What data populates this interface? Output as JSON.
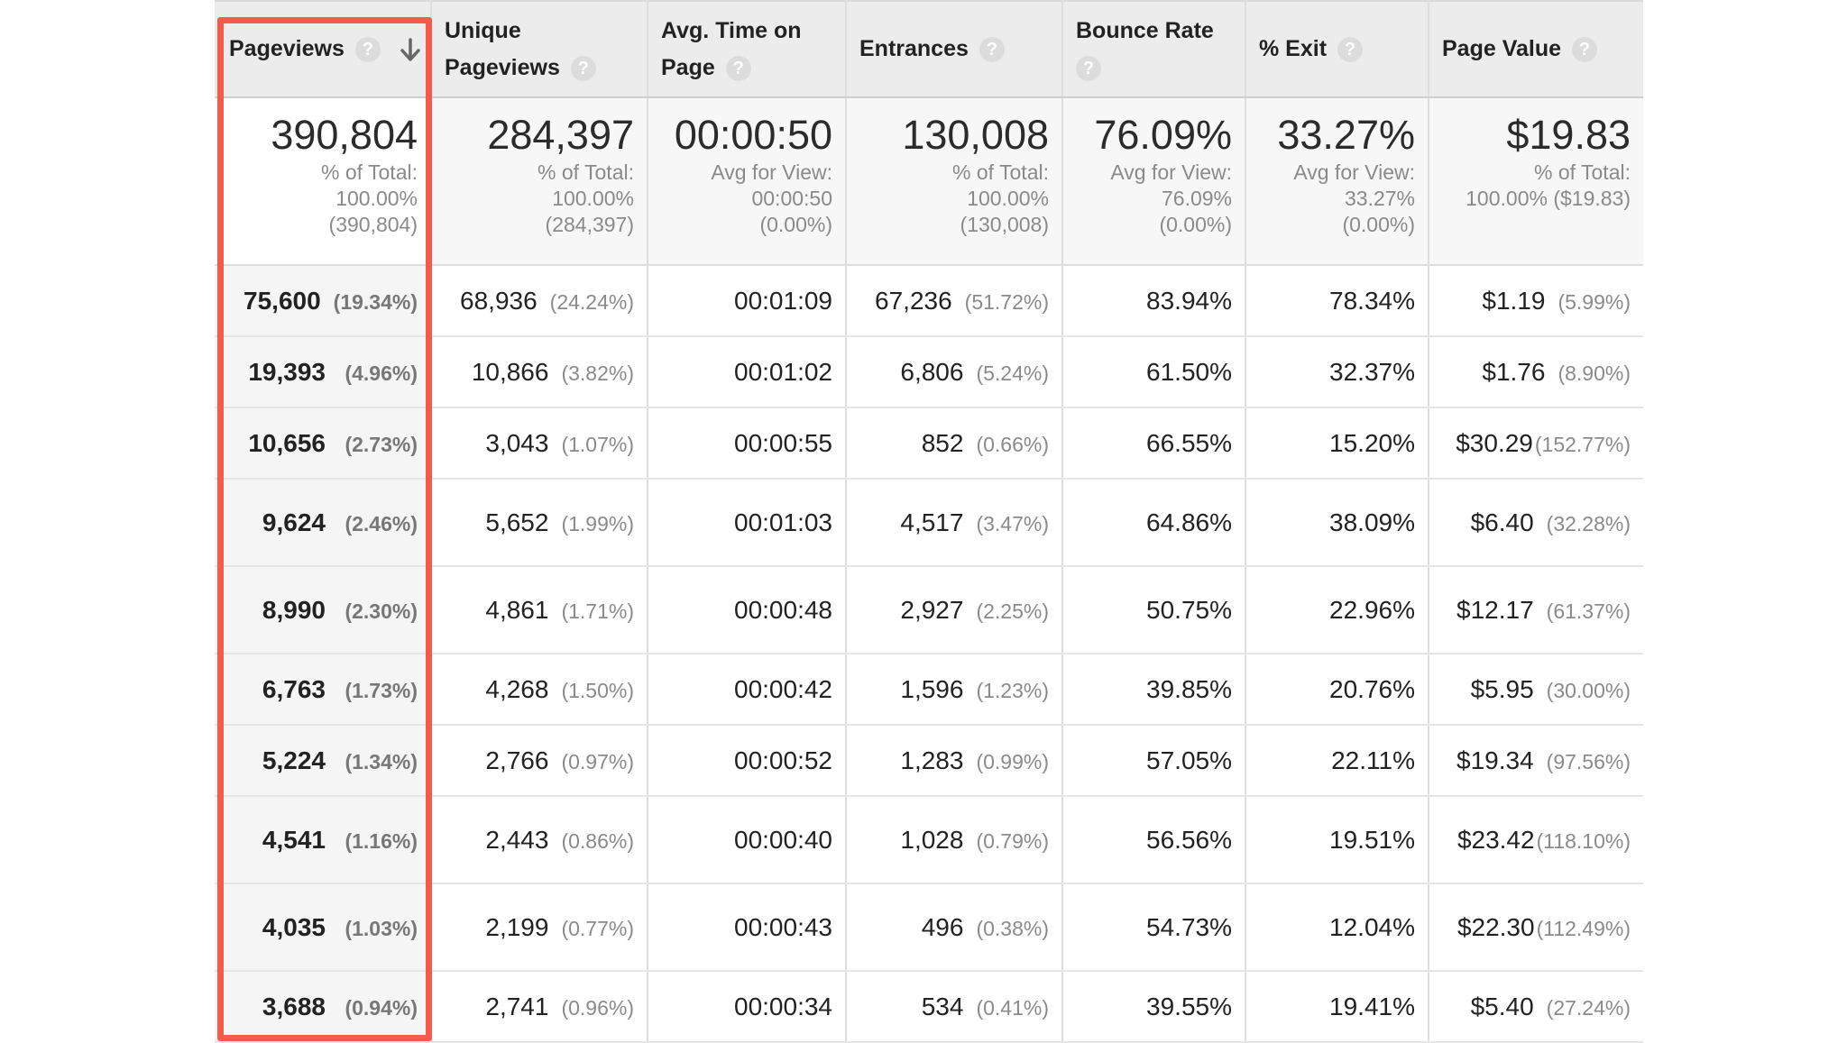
{
  "colors": {
    "highlight": "#f25c4d",
    "header_bg": "#ececec",
    "total_bg": "#f7f7f7"
  },
  "help_glyph": "?",
  "headers": [
    {
      "line1": "Pageviews",
      "line2": ""
    },
    {
      "line1": "Unique",
      "line2": "Pageviews"
    },
    {
      "line1": "Avg. Time on",
      "line2": "Page"
    },
    {
      "line1": "Entrances",
      "line2": ""
    },
    {
      "line1": "Bounce Rate",
      "line2": ""
    },
    {
      "line1": "% Exit",
      "line2": ""
    },
    {
      "line1": "Page Value",
      "line2": ""
    }
  ],
  "totals": [
    {
      "value": "390,804",
      "l1": "% of Total:",
      "l2": "100.00%",
      "l3": "(390,804)"
    },
    {
      "value": "284,397",
      "l1": "% of Total:",
      "l2": "100.00%",
      "l3": "(284,397)"
    },
    {
      "value": "00:00:50",
      "l1": "Avg for View:",
      "l2": "00:00:50",
      "l3": "(0.00%)"
    },
    {
      "value": "130,008",
      "l1": "% of Total:",
      "l2": "100.00%",
      "l3": "(130,008)"
    },
    {
      "value": "76.09%",
      "l1": "Avg for View:",
      "l2": "76.09%",
      "l3": "(0.00%)"
    },
    {
      "value": "33.27%",
      "l1": "Avg for View:",
      "l2": "33.27%",
      "l3": "(0.00%)"
    },
    {
      "value": "$19.83",
      "l1": "% of Total:",
      "l2": "100.00% ($19.83)",
      "l3": ""
    }
  ],
  "rows": [
    {
      "pv": "75,600",
      "pv_pct": "(19.34%)",
      "upv": "68,936",
      "upv_pct": "(24.24%)",
      "time": "00:01:09",
      "ent": "67,236",
      "ent_pct": "(51.72%)",
      "bounce": "83.94%",
      "exit": "78.34%",
      "value": "$1.19",
      "value_pct": "(5.99%)"
    },
    {
      "pv": "19,393",
      "pv_pct": "(4.96%)",
      "upv": "10,866",
      "upv_pct": "(3.82%)",
      "time": "00:01:02",
      "ent": "6,806",
      "ent_pct": "(5.24%)",
      "bounce": "61.50%",
      "exit": "32.37%",
      "value": "$1.76",
      "value_pct": "(8.90%)"
    },
    {
      "pv": "10,656",
      "pv_pct": "(2.73%)",
      "upv": "3,043",
      "upv_pct": "(1.07%)",
      "time": "00:00:55",
      "ent": "852",
      "ent_pct": "(0.66%)",
      "bounce": "66.55%",
      "exit": "15.20%",
      "value": "$30.29",
      "value_pct": "(152.77%)"
    },
    {
      "pv": "9,624",
      "pv_pct": "(2.46%)",
      "upv": "5,652",
      "upv_pct": "(1.99%)",
      "time": "00:01:03",
      "ent": "4,517",
      "ent_pct": "(3.47%)",
      "bounce": "64.86%",
      "exit": "38.09%",
      "value": "$6.40",
      "value_pct": "(32.28%)"
    },
    {
      "pv": "8,990",
      "pv_pct": "(2.30%)",
      "upv": "4,861",
      "upv_pct": "(1.71%)",
      "time": "00:00:48",
      "ent": "2,927",
      "ent_pct": "(2.25%)",
      "bounce": "50.75%",
      "exit": "22.96%",
      "value": "$12.17",
      "value_pct": "(61.37%)"
    },
    {
      "pv": "6,763",
      "pv_pct": "(1.73%)",
      "upv": "4,268",
      "upv_pct": "(1.50%)",
      "time": "00:00:42",
      "ent": "1,596",
      "ent_pct": "(1.23%)",
      "bounce": "39.85%",
      "exit": "20.76%",
      "value": "$5.95",
      "value_pct": "(30.00%)"
    },
    {
      "pv": "5,224",
      "pv_pct": "(1.34%)",
      "upv": "2,766",
      "upv_pct": "(0.97%)",
      "time": "00:00:52",
      "ent": "1,283",
      "ent_pct": "(0.99%)",
      "bounce": "57.05%",
      "exit": "22.11%",
      "value": "$19.34",
      "value_pct": "(97.56%)"
    },
    {
      "pv": "4,541",
      "pv_pct": "(1.16%)",
      "upv": "2,443",
      "upv_pct": "(0.86%)",
      "time": "00:00:40",
      "ent": "1,028",
      "ent_pct": "(0.79%)",
      "bounce": "56.56%",
      "exit": "19.51%",
      "value": "$23.42",
      "value_pct": "(118.10%)"
    },
    {
      "pv": "4,035",
      "pv_pct": "(1.03%)",
      "upv": "2,199",
      "upv_pct": "(0.77%)",
      "time": "00:00:43",
      "ent": "496",
      "ent_pct": "(0.38%)",
      "bounce": "54.73%",
      "exit": "12.04%",
      "value": "$22.30",
      "value_pct": "(112.49%)"
    },
    {
      "pv": "3,688",
      "pv_pct": "(0.94%)",
      "upv": "2,741",
      "upv_pct": "(0.96%)",
      "time": "00:00:34",
      "ent": "534",
      "ent_pct": "(0.41%)",
      "bounce": "39.55%",
      "exit": "19.41%",
      "value": "$5.40",
      "value_pct": "(27.24%)"
    }
  ]
}
